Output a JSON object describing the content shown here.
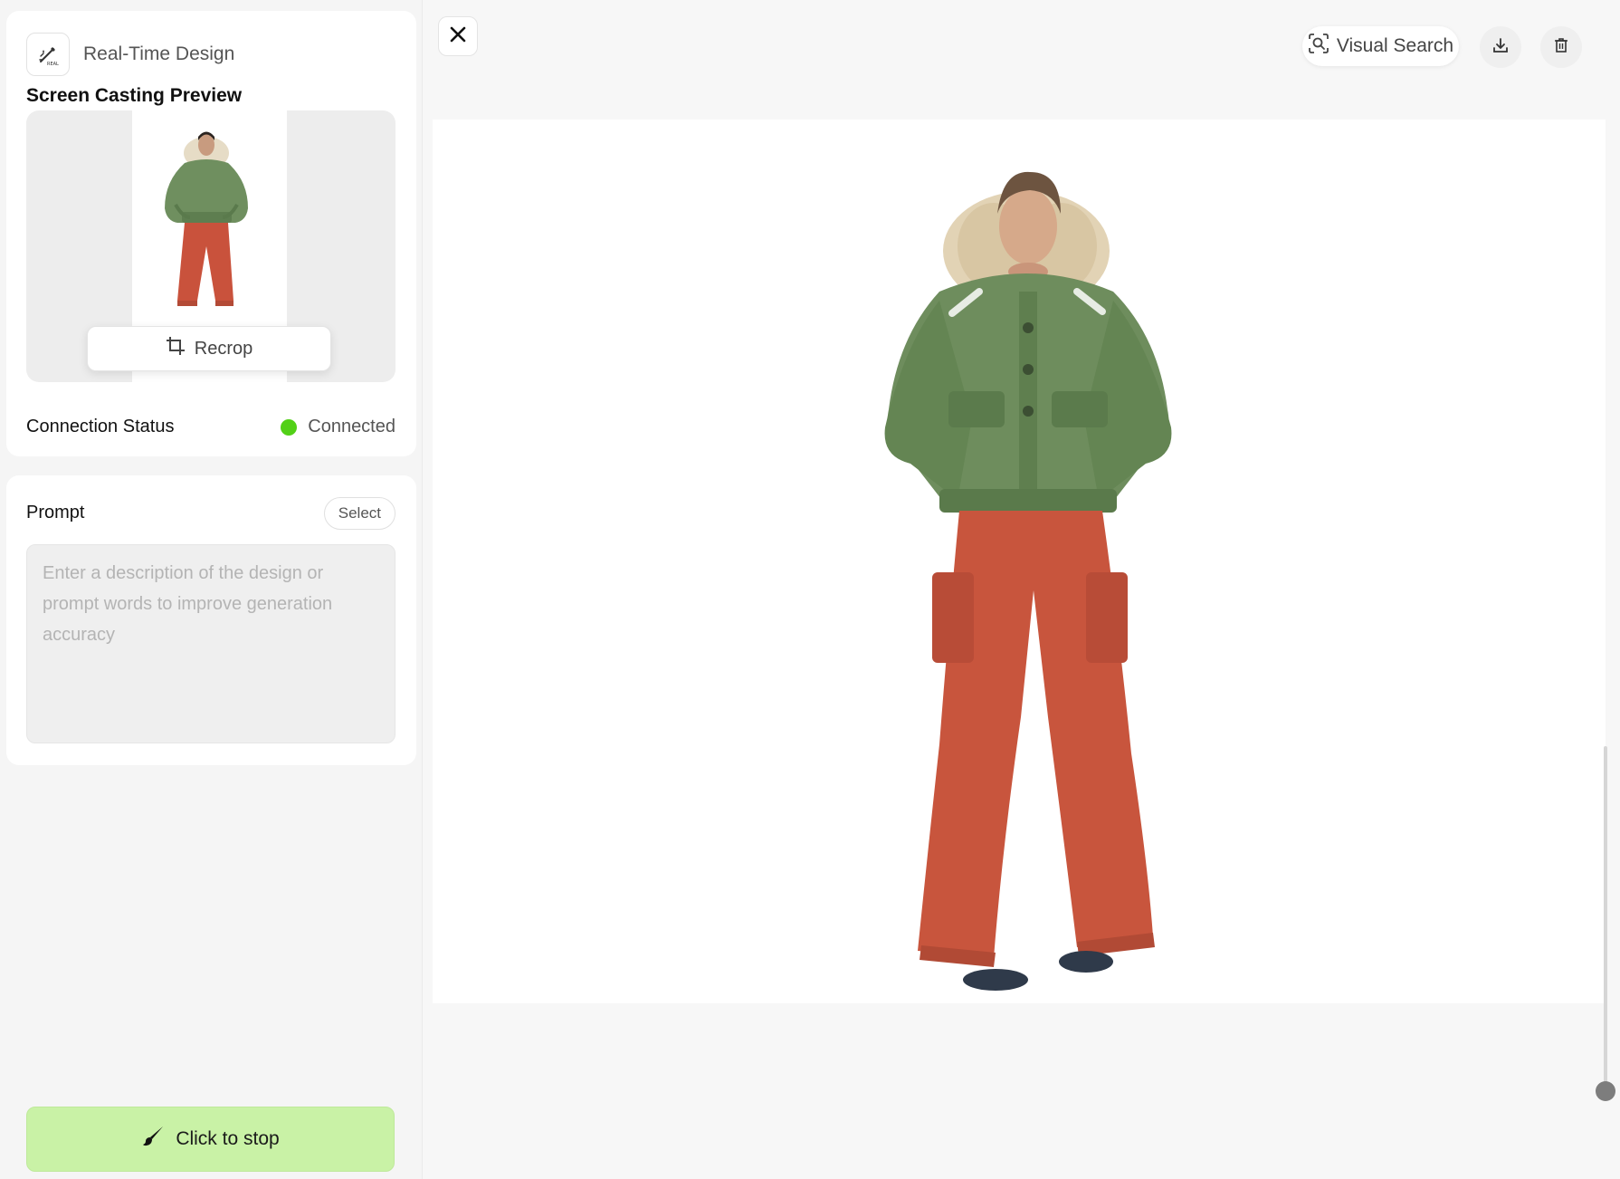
{
  "sidebar": {
    "app_title": "Real-Time Design",
    "logo_icon": "ai-brush-icon",
    "preview_title": "Screen Casting Preview",
    "recrop_label": "Recrop",
    "connection": {
      "label": "Connection Status",
      "value": "Connected",
      "color": "#52d017"
    }
  },
  "prompt": {
    "label": "Prompt",
    "select_label": "Select",
    "value": "",
    "placeholder": "Enter a description of the design or prompt words to improve generation accuracy"
  },
  "stop_button": {
    "label": "Click to stop",
    "icon": "brush-icon",
    "color": "#c9f2a6"
  },
  "toolbar": {
    "visual_search_label": "Visual Search",
    "icons": [
      "close-icon",
      "visual-search-icon",
      "download-icon",
      "trash-icon"
    ]
  },
  "canvas": {
    "image_subject": "model-in-green-puffer-jacket-and-red-wide-leg-pants"
  }
}
